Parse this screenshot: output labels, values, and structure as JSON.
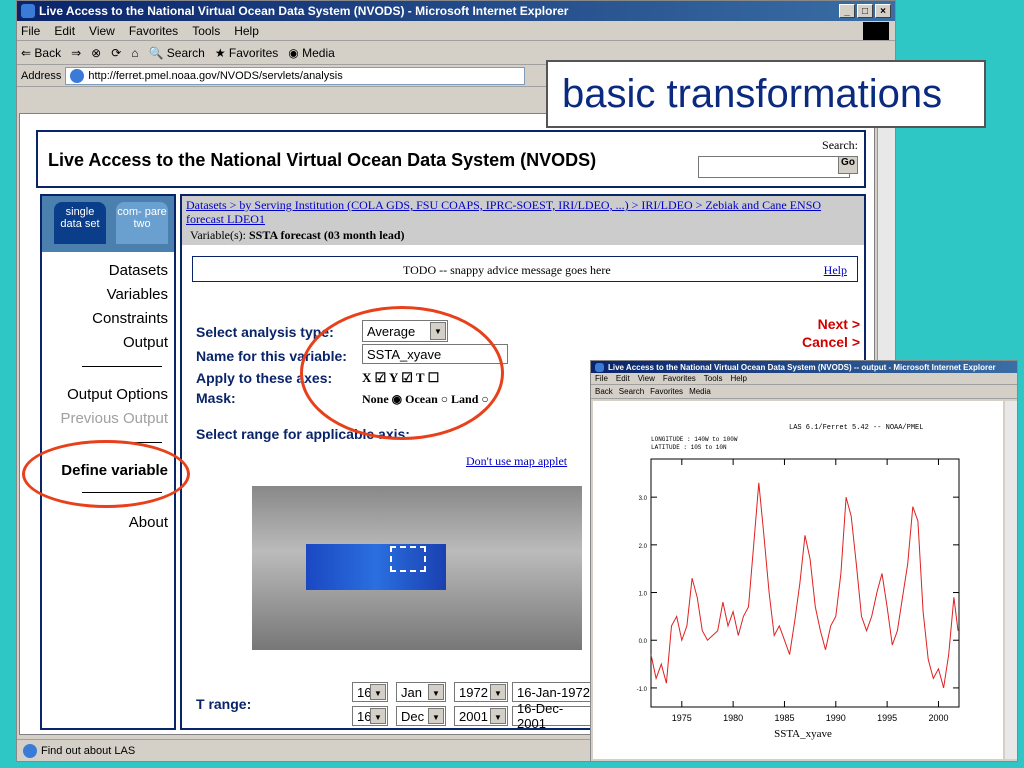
{
  "window": {
    "title": "Live Access to the National Virtual Ocean Data System (NVODS) - Microsoft Internet Explorer",
    "menu": [
      "File",
      "Edit",
      "View",
      "Favorites",
      "Tools",
      "Help"
    ],
    "toolbar": [
      "Back",
      "Search",
      "Favorites",
      "Media"
    ],
    "address_label": "Address",
    "address_url": "http://ferret.pmel.noaa.gov/NVODS/servlets/analysis",
    "status_text": "Find out about LAS"
  },
  "overlay_title": "basic transformations",
  "page": {
    "title": "Live Access to the National Virtual Ocean Data System (NVODS)",
    "search_label": "Search:",
    "go_label": "Go",
    "tabs": [
      "single data set",
      "com- pare two"
    ],
    "nav": [
      "Datasets",
      "Variables",
      "Constraints",
      "Output",
      "Output Options",
      "Previous Output",
      "Define variable",
      "About"
    ],
    "breadcrumb": "Datasets > by Serving Institution (COLA GDS, FSU COAPS, IPRC-SOEST, IRI/LDEO, ...) > IRI/LDEO > Zebiak and Cane ENSO forecast LDEO1",
    "variable_label": "Variable(s):",
    "variable_value": "SSTA forecast (03 month lead)",
    "advice": "TODO -- snappy advice message goes here",
    "help": "Help",
    "next": "Next >",
    "cancel": "Cancel >",
    "analysis_type_label": "Select analysis type:",
    "analysis_type_value": "Average",
    "var_name_label": "Name for this variable:",
    "var_name_value": "SSTA_xyave",
    "axes_label": "Apply to these axes:",
    "axes": "X ☑ Y ☑ T ☐",
    "mask_label": "Mask:",
    "mask": "None ◉ Ocean ○ Land ○",
    "range_label": "Select range for applicable axis:",
    "map_link": "Don't use map applet",
    "t_range_label": "T range:",
    "t_start": {
      "day": "16",
      "month": "Jan",
      "year": "1972",
      "text": "16-Jan-1972"
    },
    "t_end": {
      "day": "16",
      "month": "Dec",
      "year": "2001",
      "text": "16-Dec-2001"
    }
  },
  "output_window": {
    "title": "Live Access to the National Virtual Ocean Data System (NVODS) -- output - Microsoft Internet Explorer",
    "header": "LAS 6.1/Ferret 5.42 -- NOAA/PMEL",
    "longitude": "LONGITUDE : 140W to 100W",
    "latitude": "LATITUDE : 10S to 10N",
    "xlabel": "SSTA_xyave"
  },
  "chart_data": {
    "type": "line",
    "xlim": [
      1972,
      2002
    ],
    "ylim": [
      -1.4,
      3.8
    ],
    "xticks": [
      "1975",
      "1980",
      "1985",
      "1990",
      "1995",
      "2000"
    ],
    "yticks": [
      "-1.0",
      "0.0",
      "1.0",
      "2.0",
      "3.0"
    ],
    "color": "#e02020",
    "x": [
      1972.0,
      1972.5,
      1973.0,
      1973.5,
      1974.0,
      1974.5,
      1975.0,
      1975.5,
      1976.0,
      1976.5,
      1977.0,
      1977.5,
      1978.0,
      1978.5,
      1979.0,
      1979.5,
      1980.0,
      1980.5,
      1981.0,
      1981.5,
      1982.0,
      1982.5,
      1983.0,
      1983.5,
      1984.0,
      1984.5,
      1985.0,
      1985.5,
      1986.0,
      1986.5,
      1987.0,
      1987.5,
      1988.0,
      1988.5,
      1989.0,
      1989.5,
      1990.0,
      1990.5,
      1991.0,
      1991.5,
      1992.0,
      1992.5,
      1993.0,
      1993.5,
      1994.0,
      1994.5,
      1995.0,
      1995.5,
      1996.0,
      1996.5,
      1997.0,
      1997.5,
      1998.0,
      1998.5,
      1999.0,
      1999.5,
      2000.0,
      2000.5,
      2001.0,
      2001.5,
      2001.9
    ],
    "y": [
      -0.3,
      -0.8,
      -0.5,
      -0.9,
      0.3,
      0.5,
      0.0,
      0.3,
      1.3,
      0.9,
      0.2,
      0.0,
      0.1,
      0.2,
      0.8,
      0.3,
      0.6,
      0.1,
      0.5,
      0.7,
      2.0,
      3.3,
      2.2,
      1.0,
      0.1,
      0.3,
      0.0,
      -0.3,
      0.4,
      1.2,
      2.2,
      1.7,
      0.7,
      0.2,
      -0.2,
      0.3,
      0.5,
      1.4,
      3.0,
      2.6,
      1.6,
      0.5,
      0.2,
      0.5,
      1.0,
      1.4,
      0.7,
      -0.1,
      0.2,
      0.9,
      1.6,
      2.8,
      2.5,
      0.6,
      -0.4,
      -0.8,
      -0.6,
      -1.0,
      -0.3,
      0.9,
      0.2
    ]
  }
}
